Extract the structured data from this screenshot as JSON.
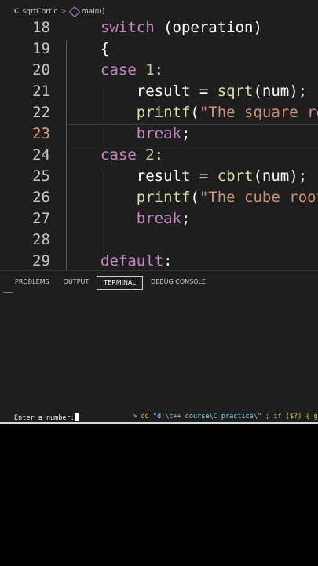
{
  "breadcrumb": {
    "lang_glyph": "C",
    "file": "sqrtCbrt.c",
    "separator": ">",
    "symbol": "main()"
  },
  "editor": {
    "active_line": 23,
    "lines": [
      {
        "num": "18",
        "tokens": [
          {
            "t": "switch",
            "c": "kw"
          },
          {
            "t": " (operation)",
            "c": "plain"
          }
        ]
      },
      {
        "num": "19",
        "tokens": [
          {
            "t": "{",
            "c": "plain"
          }
        ]
      },
      {
        "num": "20",
        "tokens": [
          {
            "t": "case",
            "c": "kw"
          },
          {
            "t": " ",
            "c": "plain"
          },
          {
            "t": "1",
            "c": "num"
          },
          {
            "t": ":",
            "c": "plain"
          }
        ]
      },
      {
        "num": "21",
        "tokens": [
          {
            "t": "    result = ",
            "c": "plain"
          },
          {
            "t": "sqrt",
            "c": "fn"
          },
          {
            "t": "(num);",
            "c": "plain"
          }
        ]
      },
      {
        "num": "22",
        "tokens": [
          {
            "t": "    ",
            "c": "plain"
          },
          {
            "t": "printf",
            "c": "fn"
          },
          {
            "t": "(",
            "c": "plain"
          },
          {
            "t": "\"The square ro",
            "c": "str"
          }
        ]
      },
      {
        "num": "23",
        "tokens": [
          {
            "t": "    ",
            "c": "plain"
          },
          {
            "t": "break",
            "c": "kw"
          },
          {
            "t": ";",
            "c": "plain"
          }
        ]
      },
      {
        "num": "24",
        "tokens": [
          {
            "t": "case",
            "c": "kw"
          },
          {
            "t": " ",
            "c": "plain"
          },
          {
            "t": "2",
            "c": "num"
          },
          {
            "t": ":",
            "c": "plain"
          }
        ]
      },
      {
        "num": "25",
        "tokens": [
          {
            "t": "    result = ",
            "c": "plain"
          },
          {
            "t": "cbrt",
            "c": "fn"
          },
          {
            "t": "(num);",
            "c": "plain"
          }
        ]
      },
      {
        "num": "26",
        "tokens": [
          {
            "t": "    ",
            "c": "plain"
          },
          {
            "t": "printf",
            "c": "fn"
          },
          {
            "t": "(",
            "c": "plain"
          },
          {
            "t": "\"The cube root",
            "c": "str"
          }
        ]
      },
      {
        "num": "27",
        "tokens": [
          {
            "t": "    ",
            "c": "plain"
          },
          {
            "t": "break",
            "c": "kw"
          },
          {
            "t": ";",
            "c": "plain"
          }
        ]
      },
      {
        "num": "28",
        "tokens": []
      },
      {
        "num": "29",
        "tokens": [
          {
            "t": "default",
            "c": "kw"
          },
          {
            "t": ":",
            "c": "plain"
          }
        ]
      }
    ]
  },
  "panel": {
    "tabs": [
      {
        "label": "PROBLEMS",
        "active": false
      },
      {
        "label": "OUTPUT",
        "active": false
      },
      {
        "label": "TERMINAL",
        "active": true
      },
      {
        "label": "DEBUG CONSOLE",
        "active": false
      }
    ],
    "terminal": {
      "command_prefix": "> ",
      "command_cd": "cd ",
      "command_path": "\"d:\\c++ course\\C practice\\\"",
      "command_rest": " ; if ($?) { gcc",
      "prompt": "Enter a number:"
    }
  }
}
